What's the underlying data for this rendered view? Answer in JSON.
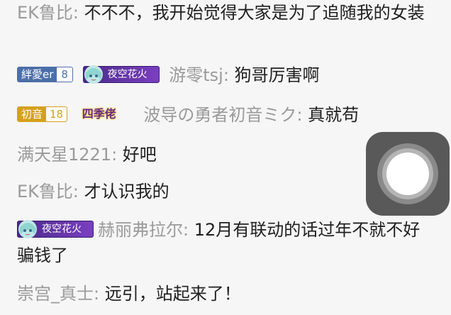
{
  "messages": [
    {
      "user": "EK鲁比",
      "colon": ":",
      "text": " 不不不，我开始觉得大家是为了追随我的女装"
    },
    {
      "fan_badge": {
        "name": "絆愛er",
        "level": "8"
      },
      "title_badge": "夜空花火",
      "user": "游零tsj",
      "colon": ":",
      "text": " 狗哥厉害啊"
    },
    {
      "fan_badge": {
        "name": "初音",
        "level": "18"
      },
      "title_badge": "四季佬",
      "user": "波导の勇者初音ミク",
      "colon": ":",
      "text": " 真就苟"
    },
    {
      "user": "满天星1221",
      "colon": ":",
      "text": " 好吧"
    },
    {
      "user": "EK鲁比",
      "colon": ":",
      "text": " 才认识我的"
    },
    {
      "title_badge": "夜空花火",
      "user": "赫丽弗拉尔",
      "colon": ":",
      "text": " 12月有联动的话过年不就不好骗钱了"
    },
    {
      "user": "崇宫_真士",
      "colon": ":",
      "text": " 远引，站起来了！"
    }
  ],
  "colors": {
    "background": "#f6f6f6",
    "username": "#9a9a9a",
    "message_text": "#202020",
    "fan_blue": "#4c6fa9",
    "fan_gold": "#d5a11c",
    "badge_purple": "#5a2f9e",
    "assistive_touch": "#595959"
  },
  "icons": {
    "assistive_touch": "assistive-touch-icon",
    "avatar": "anime-avatar-icon"
  }
}
